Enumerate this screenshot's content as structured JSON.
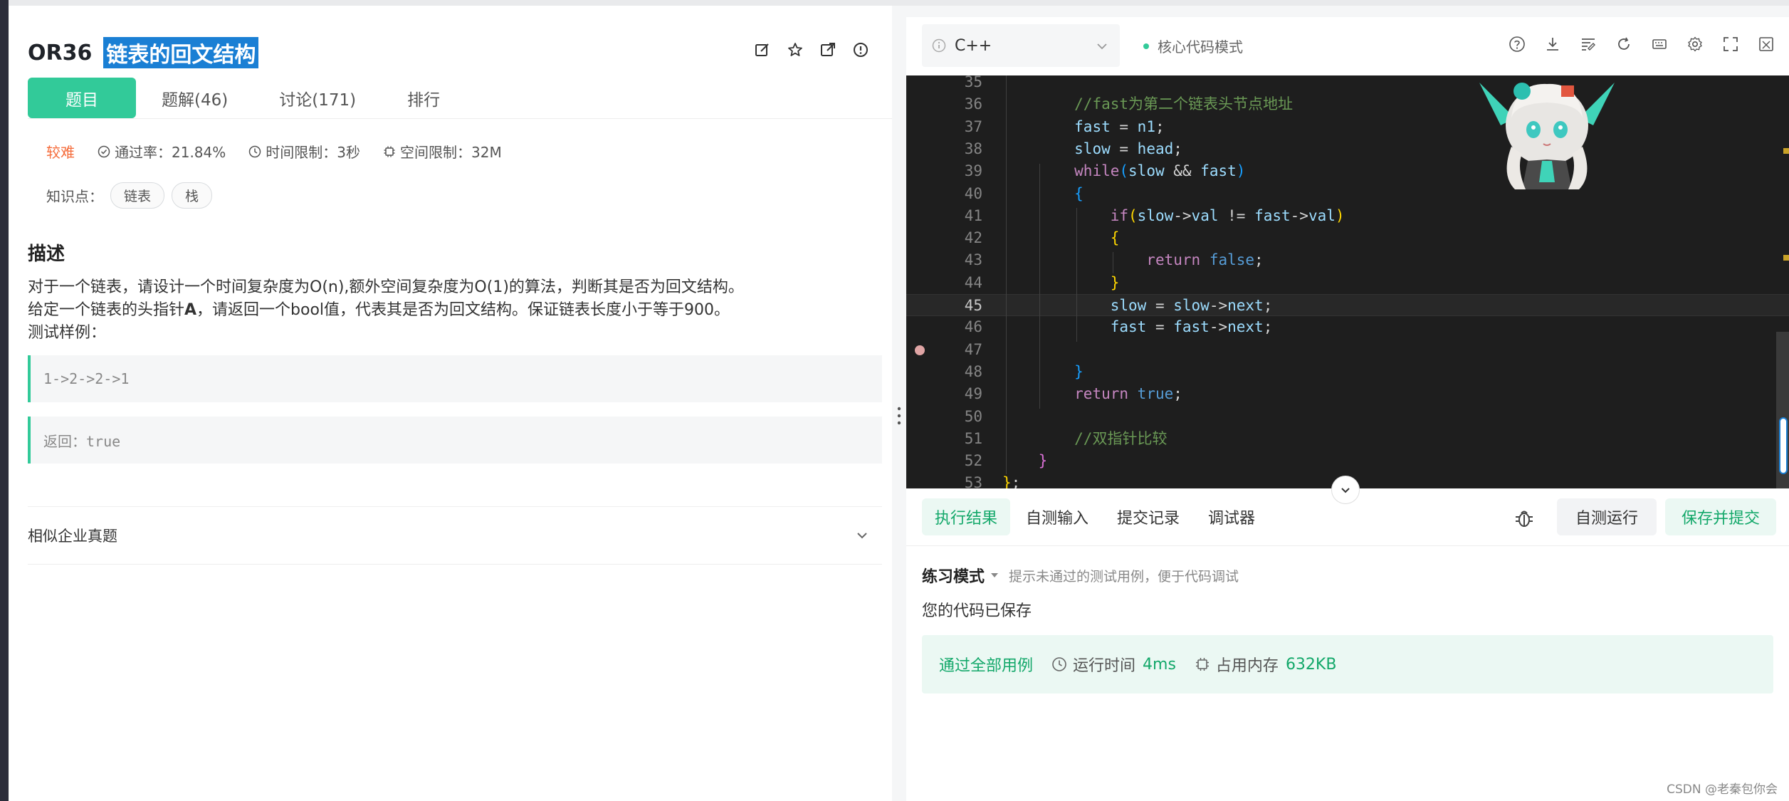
{
  "problem": {
    "code": "OR36",
    "name": "链表的回文结构"
  },
  "tabs": [
    {
      "label": "题目"
    },
    {
      "label": "题解(46)"
    },
    {
      "label": "讨论(171)"
    },
    {
      "label": "排行"
    }
  ],
  "meta": {
    "difficulty": "较难",
    "pass_rate": "通过率：21.84%",
    "time_limit": "时间限制：3秒",
    "space_limit": "空间限制：32M"
  },
  "knowledge": {
    "label": "知识点：",
    "tags": [
      "链表",
      "栈"
    ]
  },
  "description": {
    "title": "描述",
    "line1": "对于一个链表，请设计一个时间复杂度为O(n),额外空间复杂度为O(1)的算法，判断其是否为回文结构。",
    "line2_pre": "给定一个链表的头指针",
    "line2_bold": "A",
    "line2_post": "，请返回一个bool值，代表其是否为回文结构。保证链表长度小于等于900。",
    "line3": "测试样例：",
    "sample_input": "1->2->2->1",
    "sample_output": "返回：true"
  },
  "similar": {
    "label": "相似企业真题"
  },
  "editor": {
    "language": "C++",
    "mode": "核心代码模式",
    "current_line": 45
  },
  "code_lines": [
    {
      "n": "35",
      "segs": []
    },
    {
      "n": "36",
      "segs": [
        [
          "        ",
          ""
        ],
        [
          "//fast为第二个链表头节点地址",
          "c-com"
        ]
      ]
    },
    {
      "n": "37",
      "segs": [
        [
          "        ",
          ""
        ],
        [
          "fast",
          "c-var"
        ],
        [
          " = ",
          ""
        ],
        [
          "n1",
          "c-var"
        ],
        [
          ";",
          ""
        ]
      ]
    },
    {
      "n": "38",
      "segs": [
        [
          "        ",
          ""
        ],
        [
          "slow",
          "c-var"
        ],
        [
          " = ",
          ""
        ],
        [
          "head",
          "c-var"
        ],
        [
          ";",
          ""
        ]
      ]
    },
    {
      "n": "39",
      "segs": [
        [
          "        ",
          ""
        ],
        [
          "while",
          "c-key"
        ],
        [
          "(",
          "c-b"
        ],
        [
          "slow",
          "c-var"
        ],
        [
          " && ",
          ""
        ],
        [
          "fast",
          "c-var"
        ],
        [
          ")",
          "c-b"
        ]
      ]
    },
    {
      "n": "40",
      "segs": [
        [
          "        ",
          ""
        ],
        [
          "{",
          "c-b"
        ]
      ]
    },
    {
      "n": "41",
      "segs": [
        [
          "            ",
          ""
        ],
        [
          "if",
          "c-key"
        ],
        [
          "(",
          "c-y"
        ],
        [
          "slow",
          "c-var"
        ],
        [
          "->",
          ""
        ],
        [
          "val",
          "c-var"
        ],
        [
          " != ",
          ""
        ],
        [
          "fast",
          "c-var"
        ],
        [
          "->",
          ""
        ],
        [
          "val",
          "c-var"
        ],
        [
          ")",
          "c-y"
        ]
      ]
    },
    {
      "n": "42",
      "segs": [
        [
          "            ",
          ""
        ],
        [
          "{",
          "c-y"
        ]
      ]
    },
    {
      "n": "43",
      "segs": [
        [
          "                ",
          ""
        ],
        [
          "return",
          "c-key"
        ],
        [
          " ",
          ""
        ],
        [
          "false",
          "c-bool"
        ],
        [
          ";",
          ""
        ]
      ]
    },
    {
      "n": "44",
      "segs": [
        [
          "            ",
          ""
        ],
        [
          "}",
          "c-y"
        ]
      ]
    },
    {
      "n": "45",
      "segs": [
        [
          "            ",
          ""
        ],
        [
          "slow",
          "c-var"
        ],
        [
          " = ",
          ""
        ],
        [
          "slow",
          "c-var"
        ],
        [
          "->",
          ""
        ],
        [
          "next",
          "c-var"
        ],
        [
          ";",
          ""
        ]
      ]
    },
    {
      "n": "46",
      "segs": [
        [
          "            ",
          ""
        ],
        [
          "fast",
          "c-var"
        ],
        [
          " = ",
          ""
        ],
        [
          "fast",
          "c-var"
        ],
        [
          "->",
          ""
        ],
        [
          "next",
          "c-var"
        ],
        [
          ";",
          ""
        ]
      ]
    },
    {
      "n": "47",
      "segs": []
    },
    {
      "n": "48",
      "segs": [
        [
          "        ",
          ""
        ],
        [
          "}",
          "c-b"
        ]
      ]
    },
    {
      "n": "49",
      "segs": [
        [
          "        ",
          ""
        ],
        [
          "return",
          "c-key"
        ],
        [
          " ",
          ""
        ],
        [
          "true",
          "c-bool"
        ],
        [
          ";",
          ""
        ]
      ]
    },
    {
      "n": "50",
      "segs": []
    },
    {
      "n": "51",
      "segs": [
        [
          "        ",
          ""
        ],
        [
          "//双指针比较",
          "c-com"
        ]
      ]
    },
    {
      "n": "52",
      "segs": [
        [
          "    ",
          ""
        ],
        [
          "}",
          "c-p"
        ]
      ]
    },
    {
      "n": "53",
      "segs": [
        [
          "}",
          "c-y"
        ],
        [
          ";",
          ""
        ]
      ]
    }
  ],
  "result": {
    "tabs": [
      "执行结果",
      "自测输入",
      "提交记录",
      "调试器"
    ],
    "run_button": "自测运行",
    "submit_button": "保存并提交",
    "mode_label": "练习模式",
    "hint": "提示未通过的测试用例，便于代码调试",
    "saved_msg": "您的代码已保存",
    "pass_msg": "通过全部用例",
    "runtime_label": "运行时间",
    "runtime_value": "4ms",
    "memory_label": "占用内存",
    "memory_value": "632KB"
  },
  "watermark": "CSDN @老秦包你会",
  "colors": {
    "accent": "#32ca99",
    "editor_bg": "#1e1e1e",
    "highlight": "#1a7fd4"
  }
}
